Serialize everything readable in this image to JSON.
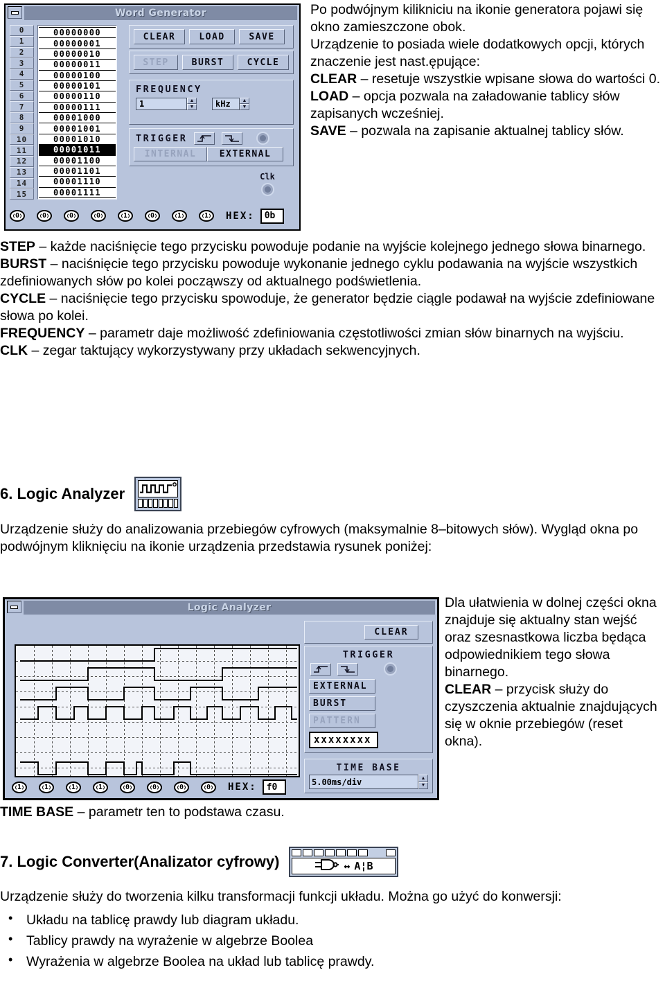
{
  "word_generator": {
    "title": "Word Generator",
    "minimize_icon": "minimize-icon",
    "indices": [
      "0",
      "1",
      "2",
      "3",
      "4",
      "5",
      "6",
      "7",
      "8",
      "9",
      "10",
      "11",
      "12",
      "13",
      "14",
      "15"
    ],
    "words": [
      "00000000",
      "00000001",
      "00000010",
      "00000011",
      "00000100",
      "00000101",
      "00000110",
      "00000111",
      "00001000",
      "00001001",
      "00001010",
      "00001011",
      "00001100",
      "00001101",
      "00001110",
      "00001111"
    ],
    "selected_index": 11,
    "buttons_row1": [
      "CLEAR",
      "LOAD",
      "SAVE"
    ],
    "buttons_row2": [
      {
        "label": "STEP",
        "disabled": true
      },
      {
        "label": "BURST",
        "disabled": false
      },
      {
        "label": "CYCLE",
        "disabled": false
      }
    ],
    "frequency": {
      "label": "FREQUENCY",
      "value": "1",
      "unit": "kHz",
      "up_arrow": "▲",
      "down_arrow": "▼"
    },
    "trigger": {
      "label": "TRIGGER",
      "rising_edge_icon": "rising-edge-icon",
      "falling_edge_icon": "falling-edge-icon",
      "led_icon": "trigger-led",
      "internal_label": "INTERNAL",
      "external_label": "EXTERNAL"
    },
    "clk": {
      "label": "Clk",
      "led_icon": "clk-led"
    },
    "bits": [
      "0",
      "0",
      "0",
      "0",
      "1",
      "0",
      "1",
      "1"
    ],
    "hex_label": "HEX:",
    "hex_value": "0b"
  },
  "text_col_right_top": {
    "p1": "Po podwójnym kilikniciu na ikonie generatora pojawi się okno zamieszczone obok.",
    "p2": "Urządzenie to posiada wiele dodatkowych opcji, których znaczenie jest nast.ępujące:",
    "clear_term": "CLEAR",
    "clear_desc": " – resetuje wszystkie wpisane słowa do wartości 0.",
    "load_term": "LOAD",
    "load_desc": " – opcja pozwala na załadowanie tablicy słów zapisanych wcześniej.",
    "save_term": "SAVE",
    "save_desc": " – pozwala na zapisanie aktualnej tablicy słów."
  },
  "body_text_1": {
    "step_term": "STEP",
    "step_desc": " – każde naciśnięcie tego przycisku powoduje podanie na wyjście kolejnego jednego słowa binarnego.",
    "burst_term": "BURST",
    "burst_desc": " – naciśnięcie tego przycisku powoduje wykonanie jednego cyklu podawania na wyjście wszystkich zdefiniowanych słów po kolei począwszy od aktualnego podświetlenia.",
    "cycle_term": "CYCLE",
    "cycle_desc": " – naciśnięcie tego przycisku spowoduje, że generator będzie ciągle podawał na wyjście zdefiniowane słowa po kolei.",
    "frequency_term": "FREQUENCY",
    "frequency_desc": " – parametr daje możliwość zdefiniowania częstotliwości zmian słów binarnych na wyjściu.",
    "clk_term": "CLK",
    "clk_desc": " – zegar taktujący wykorzystywany przy układach sekwencyjnych."
  },
  "section6": {
    "heading": "6. Logic Analyzer",
    "icon": "logic-analyzer-icon",
    "paragraph": "Urządzenie służy do analizowania przebiegów cyfrowych (maksymalnie 8–bitowych słów). Wygląd okna po podwójnym kliknięciu na ikonie urządzenia przedstawia rysunek poniżej:"
  },
  "logic_analyzer": {
    "title": "Logic Analyzer",
    "minimize_icon": "minimize-icon",
    "clear_label": "CLEAR",
    "trigger_label": "TRIGGER",
    "rising_edge_icon": "rising-edge-icon",
    "falling_edge_icon": "falling-edge-icon",
    "led_icon": "trigger-led",
    "external_label": "EXTERNAL",
    "burst_label": "BURST",
    "pattern_label": "PATTERN",
    "pattern_value": "xxxxxxxx",
    "time_base_label": "TIME BASE",
    "time_base_value": "5.00ms/div",
    "up_arrow": "▲",
    "down_arrow": "▼",
    "bits": [
      "1",
      "1",
      "1",
      "1",
      "0",
      "0",
      "0",
      "0"
    ],
    "hex_label": "HEX:",
    "hex_value": "f0"
  },
  "text_col_right_mid": {
    "p1": "Dla ułatwienia w dolnej części okna znajduje się aktualny stan wejść oraz szesnastkowa liczba będąca odpowiednikiem tego słowa binarnego.",
    "clear_term": "CLEAR",
    "clear_desc": " – przycisk służy do czyszczenia aktualnie znajdujących się w oknie przebiegów (reset okna)."
  },
  "time_base_line": {
    "term": "TIME BASE",
    "desc": " – parametr ten to podstawa czasu."
  },
  "section7": {
    "heading": "7. Logic Converter(Analizator cyfrowy)",
    "icon": "logic-converter-icon",
    "icon_gate": "and-gate-glyph",
    "icon_arrow": "↔",
    "icon_text": "A¦B",
    "paragraph": "Urządzenie służy do tworzenia kilku transformacji funkcji układu. Można go użyć do konwersji:",
    "bullets": [
      "Układu na tablicę prawdy lub diagram układu.",
      "Tablicy prawdy na wyrażenie w algebrze Boolea",
      "Wyrażenia w algebrze Boolea na układ lub tablicę prawdy."
    ]
  },
  "colors": {
    "window_face": "#b8c4dc",
    "titlebar": "#7f8ba5",
    "field": "#ccd8ee",
    "text": "#000000"
  }
}
